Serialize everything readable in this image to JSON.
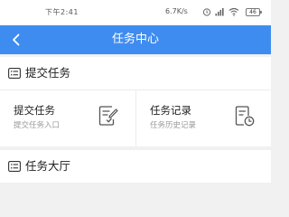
{
  "status_bar": {
    "time": "下午2:41",
    "network_speed": "6.7K/s",
    "battery": "46",
    "icons": [
      "alarm-icon",
      "sim-signal-icon",
      "wifi-icon",
      "battery-icon"
    ]
  },
  "nav": {
    "title": "任务中心",
    "back_icon": "chevron-left-icon"
  },
  "sections": {
    "submit": {
      "title": "提交任务",
      "icon": "list-icon"
    },
    "hall": {
      "title": "任务大厅",
      "icon": "list-icon"
    }
  },
  "cells": [
    {
      "title": "提交任务",
      "subtitle": "提交任务入口",
      "icon": "edit-document-icon"
    },
    {
      "title": "任务记录",
      "subtitle": "任务历史记录",
      "icon": "history-document-icon"
    }
  ],
  "colors": {
    "accent": "#3f8cf0",
    "background": "#f1f1f1",
    "text_primary": "#222222",
    "text_secondary": "#999999"
  }
}
